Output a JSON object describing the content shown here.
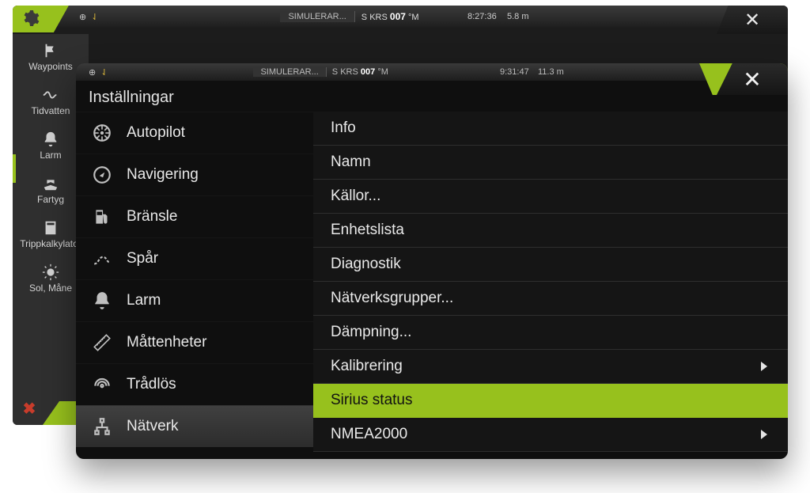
{
  "bg": {
    "simulate": "SIMULERAR...",
    "krs_prefix": "S",
    "krs_label": "KRS",
    "krs_value": "007",
    "krs_unit": "°M",
    "time": "8:27:36",
    "depth": "5.8 m",
    "close": "✕",
    "rail": [
      {
        "label": "Waypoints"
      },
      {
        "label": "Tidvatten"
      },
      {
        "label": "Larm"
      },
      {
        "label": "Fartyg"
      },
      {
        "label": "Trippkalkylator"
      },
      {
        "label": "Sol, Måne"
      }
    ]
  },
  "fg": {
    "simulate": "SIMULERAR...",
    "krs_prefix": "S",
    "krs_label": "KRS",
    "krs_value": "007",
    "krs_unit": "°M",
    "time": "9:31:47",
    "depth": "11.3 m",
    "close": "✕",
    "title": "Inställningar",
    "categories": [
      {
        "label": "Autopilot"
      },
      {
        "label": "Navigering"
      },
      {
        "label": "Bränsle"
      },
      {
        "label": "Spår"
      },
      {
        "label": "Larm"
      },
      {
        "label": "Måttenheter"
      },
      {
        "label": "Trådlös"
      },
      {
        "label": "Nätverk"
      }
    ],
    "options": [
      {
        "label": "Info",
        "arrow": false
      },
      {
        "label": "Namn",
        "arrow": false
      },
      {
        "label": "Källor...",
        "arrow": false
      },
      {
        "label": "Enhetslista",
        "arrow": false
      },
      {
        "label": "Diagnostik",
        "arrow": false
      },
      {
        "label": "Nätverksgrupper...",
        "arrow": false
      },
      {
        "label": "Dämpning...",
        "arrow": false
      },
      {
        "label": "Kalibrering",
        "arrow": true
      },
      {
        "label": "Sirius status",
        "arrow": false,
        "highlight": true
      },
      {
        "label": "NMEA2000",
        "arrow": true
      }
    ]
  }
}
